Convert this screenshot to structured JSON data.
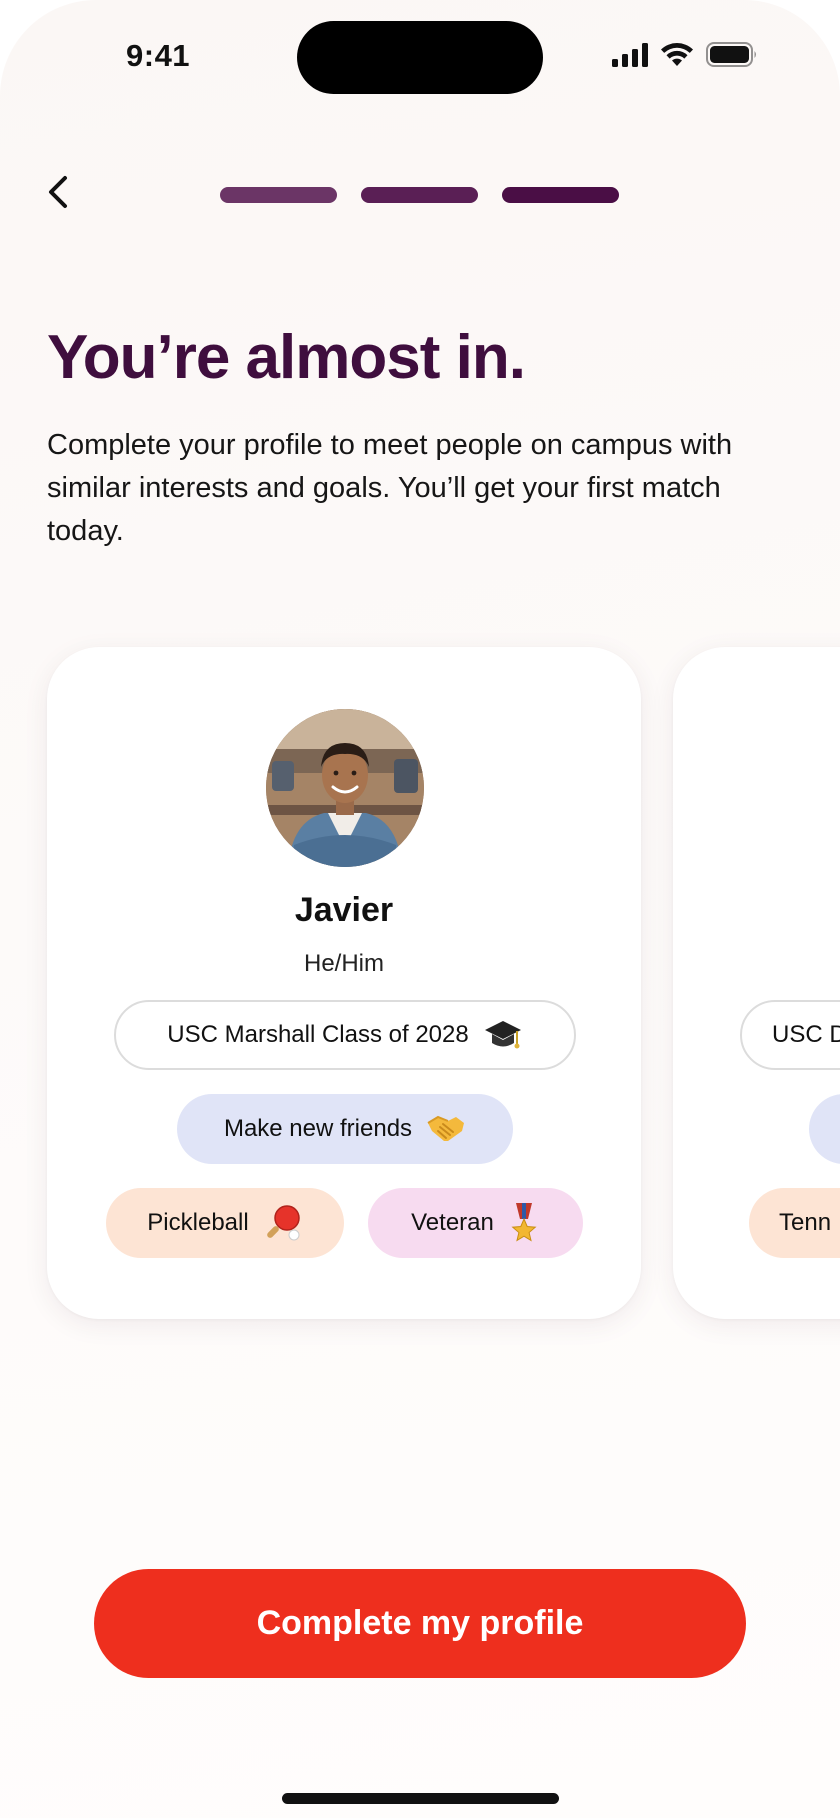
{
  "status_bar": {
    "time": "9:41",
    "icons": [
      "cellular-signal-icon",
      "wifi-icon",
      "battery-icon"
    ]
  },
  "nav": {
    "back_icon": "chevron-left-icon",
    "progress_steps": 3,
    "progress_completed": 3,
    "progress_colors": [
      "#6b3566",
      "#5a1f55",
      "#4a0e45"
    ]
  },
  "header": {
    "title": "You’re almost in.",
    "subtitle": "Complete your profile to meet people on campus with similar interests and goals. You’ll get your first match today."
  },
  "cards": [
    {
      "name": "Javier",
      "pronouns": "He/Him",
      "school": "USC Marshall Class of 2028",
      "school_icon": "graduation-cap-icon",
      "goal": "Make new friends",
      "goal_icon": "handshake-icon",
      "interest": "Pickleball",
      "interest_icon": "paddle-icon",
      "badge": "Veteran",
      "badge_icon": "military-medal-icon"
    },
    {
      "school_partial": "USC D",
      "interest_partial": "Tenn"
    }
  ],
  "cta": {
    "label": "Complete my profile"
  },
  "colors": {
    "title": "#3f0e3e",
    "cta": "#ee2f1e",
    "goal_chip": "#e0e4f7",
    "interest_chip": "#fde4d4",
    "badge_chip": "#f7dbf0"
  }
}
